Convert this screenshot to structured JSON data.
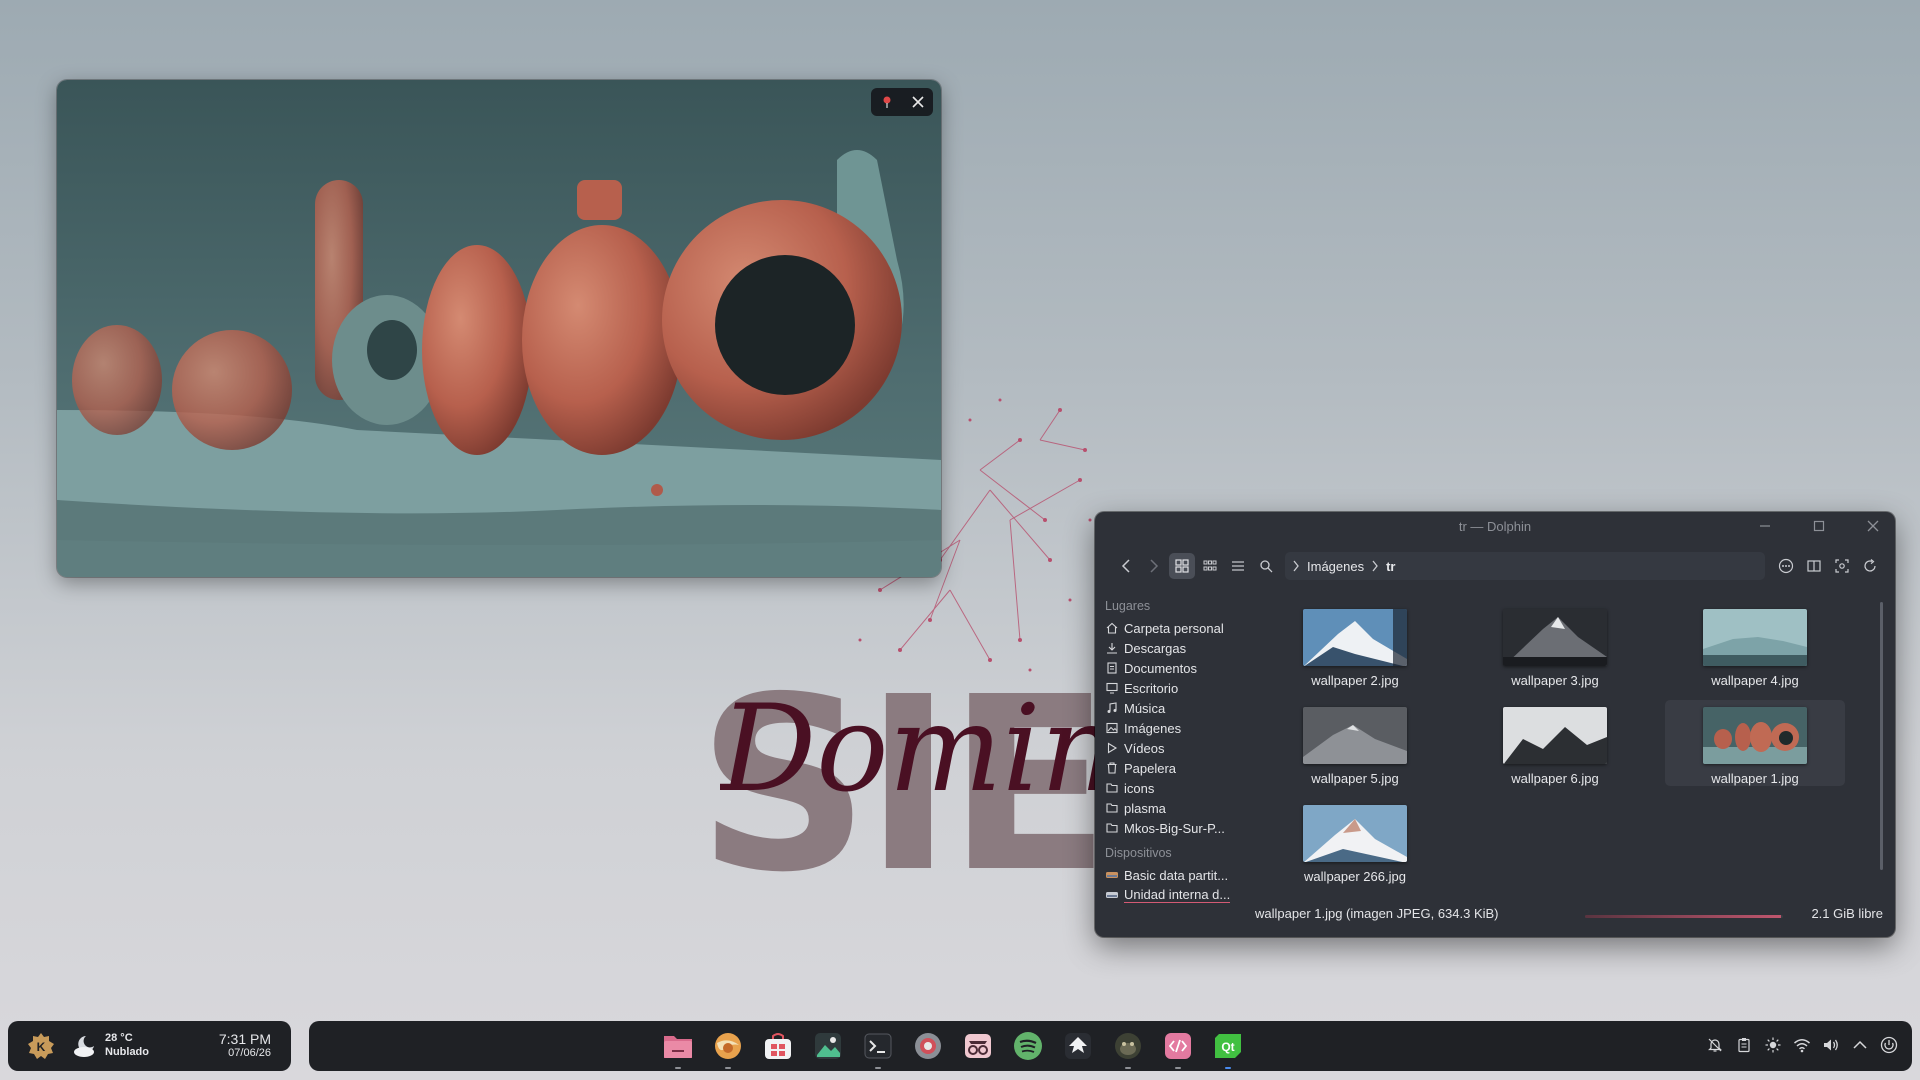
{
  "viewer": {
    "pin_icon": "pin-icon",
    "close_icon": "close-icon"
  },
  "wallpaper": {
    "big_word": "SIET",
    "script_word": "Doming"
  },
  "dolphin": {
    "title": "tr — Dolphin",
    "breadcrumb": [
      "Imágenes",
      "tr"
    ],
    "sidebar": {
      "places_header": "Lugares",
      "places": [
        {
          "label": "Carpeta personal",
          "icon": "home-icon"
        },
        {
          "label": "Descargas",
          "icon": "download-icon"
        },
        {
          "label": "Documentos",
          "icon": "document-icon"
        },
        {
          "label": "Escritorio",
          "icon": "desktop-icon"
        },
        {
          "label": "Música",
          "icon": "music-icon"
        },
        {
          "label": "Imágenes",
          "icon": "image-icon"
        },
        {
          "label": "Vídeos",
          "icon": "video-icon"
        },
        {
          "label": "Papelera",
          "icon": "trash-icon"
        },
        {
          "label": "icons",
          "icon": "folder-icon"
        },
        {
          "label": "plasma",
          "icon": "folder-icon"
        },
        {
          "label": "Mkos-Big-Sur-P...",
          "icon": "folder-icon"
        }
      ],
      "devices_header": "Dispositivos",
      "devices": [
        {
          "label": "Basic data partit...",
          "icon": "drive-icon"
        },
        {
          "label": "Unidad interna d...",
          "icon": "drive-icon"
        }
      ]
    },
    "files": [
      {
        "name": "wallpaper 2.jpg"
      },
      {
        "name": "wallpaper 3.jpg"
      },
      {
        "name": "wallpaper 4.jpg"
      },
      {
        "name": "wallpaper 5.jpg"
      },
      {
        "name": "wallpaper 6.jpg"
      },
      {
        "name": "wallpaper 1.jpg",
        "selected": true
      },
      {
        "name": "wallpaper 266.jpg"
      }
    ],
    "status": {
      "text": "wallpaper 1.jpg (imagen JPEG, 634.3 KiB)",
      "free_space": "2.1 GiB libre",
      "used_fraction": 0.99
    }
  },
  "panel": {
    "weather": {
      "temp": "28 °C",
      "condition": "Nublado"
    },
    "clock": {
      "time": "7:31 PM",
      "date": "07/06/26"
    },
    "dock_apps": [
      "files-app-icon",
      "browser-app-icon",
      "store-app-icon",
      "image-viewer-app-icon",
      "terminal-app-icon",
      "settings-app-icon",
      "privacy-app-icon",
      "spotify-app-icon",
      "inkscape-app-icon",
      "gimp-app-icon",
      "code-editor-app-icon",
      "qt-creator-app-icon"
    ],
    "tray": [
      "notifications-icon",
      "clipboard-icon",
      "brightness-icon",
      "wifi-icon",
      "volume-icon",
      "expand-tray-icon",
      "power-icon"
    ]
  },
  "colors": {
    "accent": "#d45a74",
    "panel_bg": "#1f2125",
    "window_bg": "#2e3138",
    "active_indicator": "#4a8cf0"
  }
}
